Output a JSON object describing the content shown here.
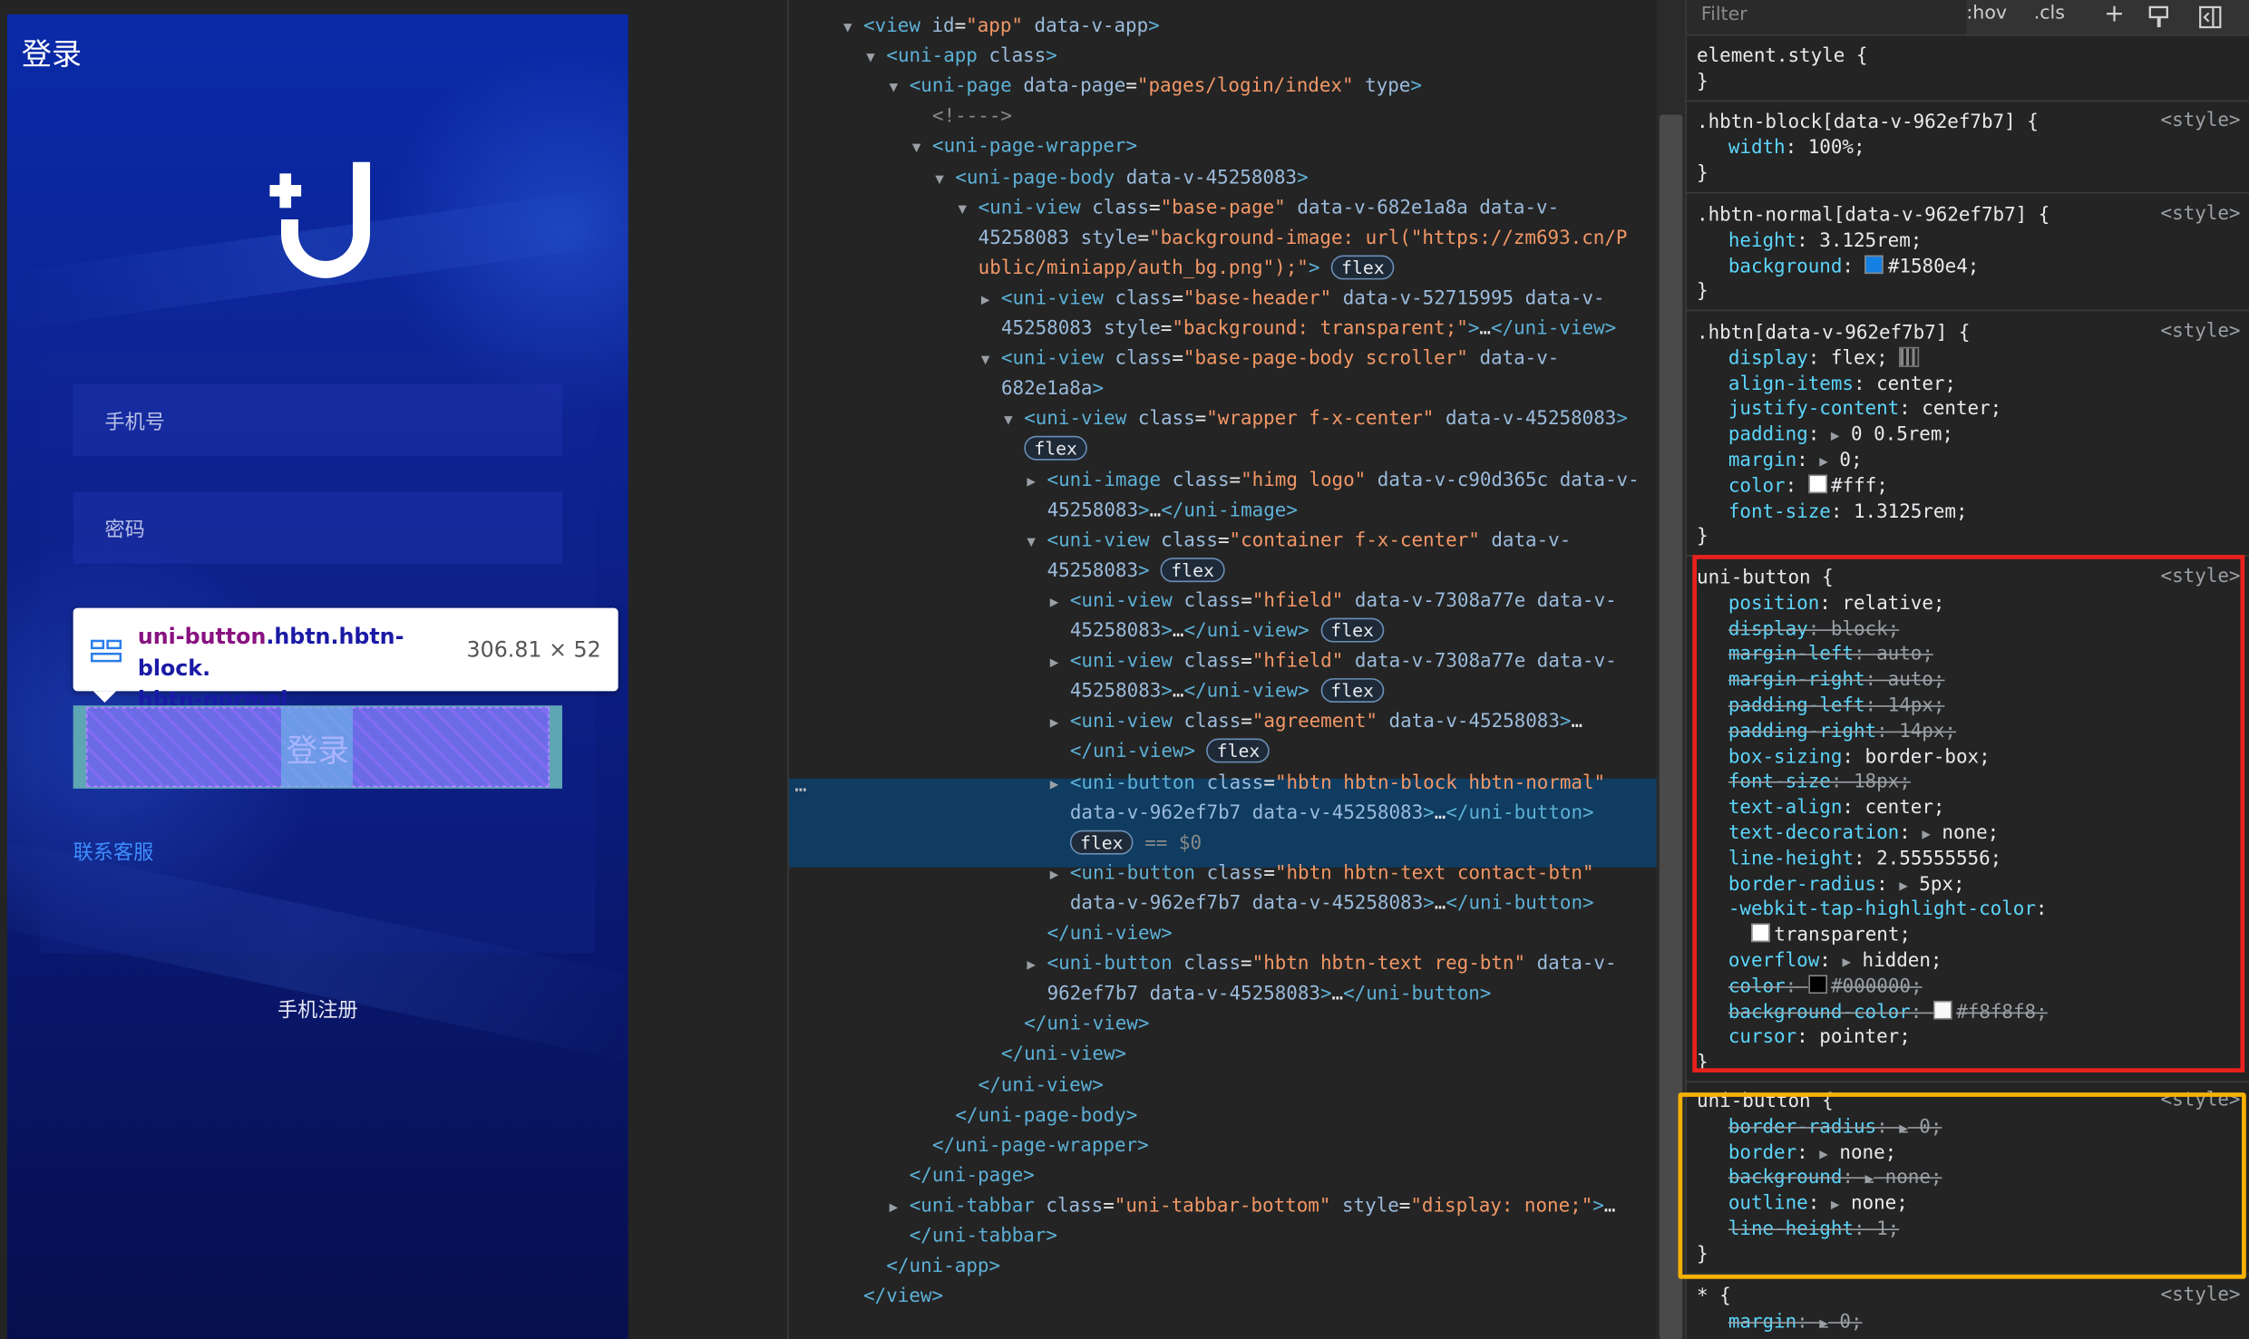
{
  "device": {
    "title": "登录",
    "phone_placeholder": "手机号",
    "password_placeholder": "密码",
    "login_label": "登录",
    "contact_label": "联系客服",
    "register_label": "手机注册",
    "tooltip": {
      "tag": "uni-button",
      "classes": ".hbtn.hbtn-block.",
      "classes2": "hbtn-normal",
      "size": "306.81 × 52"
    },
    "colors": {
      "bg_top": "#0a2aa8",
      "bg_bottom": "#070f4e",
      "link": "#3d8eff",
      "highlight": "#6b6be6"
    }
  },
  "elements": {
    "lines": [
      {
        "arrow": "▼",
        "html": "<span class='tag'>&lt;view</span> <span class='attr'>id</span>=<span class='val'>\"app\"</span> <span class='attr'>data-v-app</span><span class='tag'>&gt;</span>"
      },
      {
        "arrow": "▼",
        "html": "<span class='tag'>&lt;uni-app</span> <span class='attr'>class</span><span class='tag'>&gt;</span>"
      },
      {
        "arrow": "▼",
        "html": "<span class='tag'>&lt;uni-page</span> <span class='attr'>data-page</span>=<span class='val'>\"pages/login/index\"</span> <span class='attr'>type</span><span class='tag'>&gt;</span>"
      },
      {
        "arrow": "",
        "html": "<span class='cm'>&lt;!----&gt;</span>"
      },
      {
        "arrow": "▼",
        "html": "<span class='tag'>&lt;uni-page-wrapper&gt;</span>"
      },
      {
        "arrow": "▼",
        "html": "<span class='tag'>&lt;uni-page-body</span> <span class='attr'>data-v-45258083</span><span class='tag'>&gt;</span>"
      },
      {
        "arrow": "▼",
        "html": "<span class='tag'>&lt;uni-view</span> <span class='attr'>class</span>=<span class='val'>\"base-page\"</span> <span class='attr'>data-v-682e1a8a data-v-</span>"
      },
      {
        "arrow": "",
        "html": "<span class='attr'>45258083 style</span>=<span class='val'>\"background-image: url(\"https://zm693.cn/P</span>"
      },
      {
        "arrow": "",
        "html": "<span class='val'>ublic/miniapp/auth_bg.png\");\"</span><span class='tag'>&gt;</span> <span class='badge'>flex</span>"
      },
      {
        "arrow": "▶",
        "html": "<span class='tag'>&lt;uni-view</span> <span class='attr'>class</span>=<span class='val'>\"base-header\"</span> <span class='attr'>data-v-52715995 data-v-</span>"
      },
      {
        "arrow": "",
        "html": "<span class='attr'>45258083 style</span>=<span class='val'>\"background: transparent;\"</span><span class='tag'>&gt;</span>…<span class='tag'>&lt;/uni-view&gt;</span>"
      },
      {
        "arrow": "▼",
        "html": "<span class='tag'>&lt;uni-view</span> <span class='attr'>class</span>=<span class='val'>\"base-page-body scroller\"</span> <span class='attr'>data-v-</span>"
      },
      {
        "arrow": "",
        "html": "<span class='attr'>682e1a8a</span><span class='tag'>&gt;</span>"
      },
      {
        "arrow": "▼",
        "html": "<span class='tag'>&lt;uni-view</span> <span class='attr'>class</span>=<span class='val'>\"wrapper f-x-center\"</span> <span class='attr'>data-v-45258083</span><span class='tag'>&gt;</span>"
      },
      {
        "arrow": "",
        "html": "<span class='badge'>flex</span>"
      },
      {
        "arrow": "▶",
        "html": "<span class='tag'>&lt;uni-image</span> <span class='attr'>class</span>=<span class='val'>\"himg logo\"</span> <span class='attr'>data-v-c90d365c data-v-</span>"
      },
      {
        "arrow": "",
        "html": "<span class='attr'>45258083</span><span class='tag'>&gt;</span>…<span class='tag'>&lt;/uni-image&gt;</span>"
      },
      {
        "arrow": "▼",
        "html": "<span class='tag'>&lt;uni-view</span> <span class='attr'>class</span>=<span class='val'>\"container f-x-center\"</span> <span class='attr'>data-v-</span>"
      },
      {
        "arrow": "",
        "html": "<span class='attr'>45258083</span><span class='tag'>&gt;</span> <span class='badge'>flex</span>"
      },
      {
        "arrow": "▶",
        "html": "<span class='tag'>&lt;uni-view</span> <span class='attr'>class</span>=<span class='val'>\"hfield\"</span> <span class='attr'>data-v-7308a77e data-v-</span>"
      },
      {
        "arrow": "",
        "html": "<span class='attr'>45258083</span><span class='tag'>&gt;</span>…<span class='tag'>&lt;/uni-view&gt;</span> <span class='badge'>flex</span>"
      },
      {
        "arrow": "▶",
        "html": "<span class='tag'>&lt;uni-view</span> <span class='attr'>class</span>=<span class='val'>\"hfield\"</span> <span class='attr'>data-v-7308a77e data-v-</span>"
      },
      {
        "arrow": "",
        "html": "<span class='attr'>45258083</span><span class='tag'>&gt;</span>…<span class='tag'>&lt;/uni-view&gt;</span> <span class='badge'>flex</span>"
      },
      {
        "arrow": "▶",
        "html": "<span class='tag'>&lt;uni-view</span> <span class='attr'>class</span>=<span class='val'>\"agreement\"</span> <span class='attr'>data-v-45258083</span><span class='tag'>&gt;</span>…"
      },
      {
        "arrow": "",
        "html": "<span class='tag'>&lt;/uni-view&gt;</span> <span class='badge'>flex</span>"
      },
      {
        "arrow": "▶",
        "html": "<span class='tag'>&lt;uni-button</span> <span class='attr'>class</span>=<span class='val'>\"hbtn hbtn-block hbtn-normal\"</span>"
      },
      {
        "arrow": "",
        "html": "<span class='attr'>data-v-962ef7b7 data-v-45258083</span><span class='tag'>&gt;</span>…<span class='tag'>&lt;/uni-button&gt;</span>"
      },
      {
        "arrow": "",
        "html": "<span class='badge'>flex</span> <span class='cm'>== $0</span>"
      },
      {
        "arrow": "▶",
        "html": "<span class='tag'>&lt;uni-button</span> <span class='attr'>class</span>=<span class='val'>\"hbtn hbtn-text contact-btn\"</span>"
      },
      {
        "arrow": "",
        "html": "<span class='attr'>data-v-962ef7b7 data-v-45258083</span><span class='tag'>&gt;</span>…<span class='tag'>&lt;/uni-button&gt;</span>"
      },
      {
        "arrow": "",
        "html": "<span class='tag'>&lt;/uni-view&gt;</span>"
      },
      {
        "arrow": "▶",
        "html": "<span class='tag'>&lt;uni-button</span> <span class='attr'>class</span>=<span class='val'>\"hbtn hbtn-text reg-btn\"</span> <span class='attr'>data-v-</span>"
      },
      {
        "arrow": "",
        "html": "<span class='attr'>962ef7b7 data-v-45258083</span><span class='tag'>&gt;</span>…<span class='tag'>&lt;/uni-button&gt;</span>"
      },
      {
        "arrow": "",
        "html": "<span class='tag'>&lt;/uni-view&gt;</span>"
      },
      {
        "arrow": "",
        "html": "<span class='tag'>&lt;/uni-view&gt;</span>"
      },
      {
        "arrow": "",
        "html": "<span class='tag'>&lt;/uni-view&gt;</span>"
      },
      {
        "arrow": "",
        "html": "<span class='tag'>&lt;/uni-page-body&gt;</span>"
      },
      {
        "arrow": "",
        "html": "<span class='tag'>&lt;/uni-page-wrapper&gt;</span>"
      },
      {
        "arrow": "",
        "html": "<span class='tag'>&lt;/uni-page&gt;</span>"
      },
      {
        "arrow": "▶",
        "html": "<span class='tag'>&lt;uni-tabbar</span> <span class='attr'>class</span>=<span class='val'>\"uni-tabbar-bottom\"</span> <span class='attr'>style</span>=<span class='val'>\"display: none;\"</span><span class='tag'>&gt;</span>…"
      },
      {
        "arrow": "",
        "html": "<span class='tag'>&lt;/uni-tabbar&gt;</span>"
      },
      {
        "arrow": "",
        "html": "<span class='tag'>&lt;/uni-app&gt;</span>"
      },
      {
        "arrow": "",
        "html": "<span class='tag'>&lt;/view&gt;</span>"
      }
    ]
  },
  "styles": {
    "filter_placeholder": "Filter",
    "hov": ":hov",
    "cls": ".cls",
    "plus": "+",
    "source": "<style>",
    "rules": [
      {
        "selector": "element.style {",
        "props": [],
        "close": "}"
      },
      {
        "selector": ".hbtn-block[data-v-962ef7b7] {",
        "src": true,
        "props": [
          {
            "p": "width",
            "v": "100%;"
          }
        ],
        "close": "}"
      },
      {
        "selector": ".hbtn-normal[data-v-962ef7b7] {",
        "src": true,
        "props": [
          {
            "p": "height",
            "v": "3.125rem;"
          },
          {
            "p": "background",
            "v": "#1580e4;",
            "swatch": "#1580e4"
          }
        ],
        "close": "}"
      },
      {
        "selector": ".hbtn[data-v-962ef7b7] {",
        "src": true,
        "props": [
          {
            "p": "display",
            "v": "flex;"
          },
          {
            "p": "align-items",
            "v": "center;"
          },
          {
            "p": "justify-content",
            "v": "center;"
          },
          {
            "p": "padding",
            "v": "0 0.5rem;",
            "tri": true
          },
          {
            "p": "margin",
            "v": "0;",
            "tri": true
          },
          {
            "p": "color",
            "v": "#fff;",
            "swatch": "#ffffff"
          },
          {
            "p": "font-size",
            "v": "1.3125rem;"
          }
        ],
        "close": "}"
      },
      {
        "selector": "uni-button {",
        "src": true,
        "props": [
          {
            "p": "position",
            "v": "relative;"
          },
          {
            "p": "display",
            "v": "block;",
            "s": true
          },
          {
            "p": "margin-left",
            "v": "auto;",
            "s": true
          },
          {
            "p": "margin-right",
            "v": "auto;",
            "s": true
          },
          {
            "p": "padding-left",
            "v": "14px;",
            "s": true
          },
          {
            "p": "padding-right",
            "v": "14px;",
            "s": true
          },
          {
            "p": "box-sizing",
            "v": "border-box;"
          },
          {
            "p": "font-size",
            "v": "18px;",
            "s": true
          },
          {
            "p": "text-align",
            "v": "center;"
          },
          {
            "p": "text-decoration",
            "v": "none;",
            "tri": true
          },
          {
            "p": "line-height",
            "v": "2.55555556;"
          },
          {
            "p": "border-radius",
            "v": "5px;",
            "tri": true
          },
          {
            "p": "-webkit-tap-highlight-color",
            "v": ""
          },
          {
            "p": "",
            "v": "transparent;",
            "swatch": "#ffffff",
            "cont": true
          },
          {
            "p": "overflow",
            "v": "hidden;",
            "tri": true
          },
          {
            "p": "color",
            "v": "#000000;",
            "s": true,
            "swatch": "#000000"
          },
          {
            "p": "background-color",
            "v": "#f8f8f8;",
            "s": true,
            "swatch": "#f8f8f8"
          },
          {
            "p": "cursor",
            "v": "pointer;"
          }
        ],
        "close": "}"
      },
      {
        "selector": "uni-button {",
        "src": true,
        "props": [
          {
            "p": "border-radius",
            "v": "0;",
            "s": true,
            "tri": true
          },
          {
            "p": "border",
            "v": "none;",
            "tri": true
          },
          {
            "p": "background",
            "v": "none;",
            "s": true,
            "tri": true
          },
          {
            "p": "outline",
            "v": "none;",
            "tri": true
          },
          {
            "p": "line-height",
            "v": "1;",
            "s": true
          }
        ],
        "close": "}"
      },
      {
        "selector": "* {",
        "src": true,
        "props": [
          {
            "p": "margin",
            "v": "0;",
            "s": true,
            "tri": true
          }
        ],
        "close": ""
      }
    ]
  }
}
